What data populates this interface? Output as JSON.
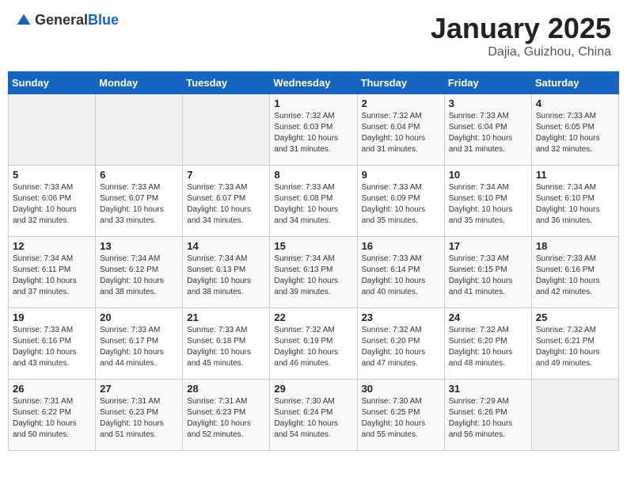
{
  "logo": {
    "text_general": "General",
    "text_blue": "Blue"
  },
  "header": {
    "month_year": "January 2025",
    "location": "Dajia, Guizhou, China"
  },
  "weekdays": [
    "Sunday",
    "Monday",
    "Tuesday",
    "Wednesday",
    "Thursday",
    "Friday",
    "Saturday"
  ],
  "weeks": [
    [
      {
        "day": "",
        "info": ""
      },
      {
        "day": "",
        "info": ""
      },
      {
        "day": "",
        "info": ""
      },
      {
        "day": "1",
        "info": "Sunrise: 7:32 AM\nSunset: 6:03 PM\nDaylight: 10 hours\nand 31 minutes."
      },
      {
        "day": "2",
        "info": "Sunrise: 7:32 AM\nSunset: 6:04 PM\nDaylight: 10 hours\nand 31 minutes."
      },
      {
        "day": "3",
        "info": "Sunrise: 7:33 AM\nSunset: 6:04 PM\nDaylight: 10 hours\nand 31 minutes."
      },
      {
        "day": "4",
        "info": "Sunrise: 7:33 AM\nSunset: 6:05 PM\nDaylight: 10 hours\nand 32 minutes."
      }
    ],
    [
      {
        "day": "5",
        "info": "Sunrise: 7:33 AM\nSunset: 6:06 PM\nDaylight: 10 hours\nand 32 minutes."
      },
      {
        "day": "6",
        "info": "Sunrise: 7:33 AM\nSunset: 6:07 PM\nDaylight: 10 hours\nand 33 minutes."
      },
      {
        "day": "7",
        "info": "Sunrise: 7:33 AM\nSunset: 6:07 PM\nDaylight: 10 hours\nand 34 minutes."
      },
      {
        "day": "8",
        "info": "Sunrise: 7:33 AM\nSunset: 6:08 PM\nDaylight: 10 hours\nand 34 minutes."
      },
      {
        "day": "9",
        "info": "Sunrise: 7:33 AM\nSunset: 6:09 PM\nDaylight: 10 hours\nand 35 minutes."
      },
      {
        "day": "10",
        "info": "Sunrise: 7:34 AM\nSunset: 6:10 PM\nDaylight: 10 hours\nand 35 minutes."
      },
      {
        "day": "11",
        "info": "Sunrise: 7:34 AM\nSunset: 6:10 PM\nDaylight: 10 hours\nand 36 minutes."
      }
    ],
    [
      {
        "day": "12",
        "info": "Sunrise: 7:34 AM\nSunset: 6:11 PM\nDaylight: 10 hours\nand 37 minutes."
      },
      {
        "day": "13",
        "info": "Sunrise: 7:34 AM\nSunset: 6:12 PM\nDaylight: 10 hours\nand 38 minutes."
      },
      {
        "day": "14",
        "info": "Sunrise: 7:34 AM\nSunset: 6:13 PM\nDaylight: 10 hours\nand 38 minutes."
      },
      {
        "day": "15",
        "info": "Sunrise: 7:34 AM\nSunset: 6:13 PM\nDaylight: 10 hours\nand 39 minutes."
      },
      {
        "day": "16",
        "info": "Sunrise: 7:33 AM\nSunset: 6:14 PM\nDaylight: 10 hours\nand 40 minutes."
      },
      {
        "day": "17",
        "info": "Sunrise: 7:33 AM\nSunset: 6:15 PM\nDaylight: 10 hours\nand 41 minutes."
      },
      {
        "day": "18",
        "info": "Sunrise: 7:33 AM\nSunset: 6:16 PM\nDaylight: 10 hours\nand 42 minutes."
      }
    ],
    [
      {
        "day": "19",
        "info": "Sunrise: 7:33 AM\nSunset: 6:16 PM\nDaylight: 10 hours\nand 43 minutes."
      },
      {
        "day": "20",
        "info": "Sunrise: 7:33 AM\nSunset: 6:17 PM\nDaylight: 10 hours\nand 44 minutes."
      },
      {
        "day": "21",
        "info": "Sunrise: 7:33 AM\nSunset: 6:18 PM\nDaylight: 10 hours\nand 45 minutes."
      },
      {
        "day": "22",
        "info": "Sunrise: 7:32 AM\nSunset: 6:19 PM\nDaylight: 10 hours\nand 46 minutes."
      },
      {
        "day": "23",
        "info": "Sunrise: 7:32 AM\nSunset: 6:20 PM\nDaylight: 10 hours\nand 47 minutes."
      },
      {
        "day": "24",
        "info": "Sunrise: 7:32 AM\nSunset: 6:20 PM\nDaylight: 10 hours\nand 48 minutes."
      },
      {
        "day": "25",
        "info": "Sunrise: 7:32 AM\nSunset: 6:21 PM\nDaylight: 10 hours\nand 49 minutes."
      }
    ],
    [
      {
        "day": "26",
        "info": "Sunrise: 7:31 AM\nSunset: 6:22 PM\nDaylight: 10 hours\nand 50 minutes."
      },
      {
        "day": "27",
        "info": "Sunrise: 7:31 AM\nSunset: 6:23 PM\nDaylight: 10 hours\nand 51 minutes."
      },
      {
        "day": "28",
        "info": "Sunrise: 7:31 AM\nSunset: 6:23 PM\nDaylight: 10 hours\nand 52 minutes."
      },
      {
        "day": "29",
        "info": "Sunrise: 7:30 AM\nSunset: 6:24 PM\nDaylight: 10 hours\nand 54 minutes."
      },
      {
        "day": "30",
        "info": "Sunrise: 7:30 AM\nSunset: 6:25 PM\nDaylight: 10 hours\nand 55 minutes."
      },
      {
        "day": "31",
        "info": "Sunrise: 7:29 AM\nSunset: 6:26 PM\nDaylight: 10 hours\nand 56 minutes."
      },
      {
        "day": "",
        "info": ""
      }
    ]
  ]
}
